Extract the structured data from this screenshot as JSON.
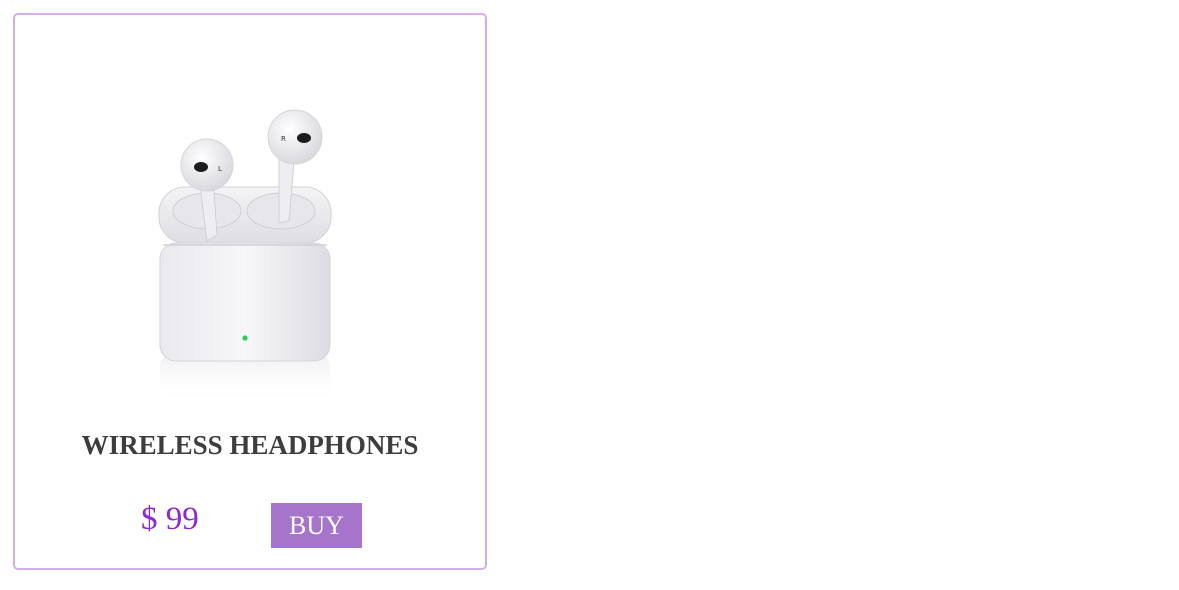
{
  "product": {
    "image_alt": "wireless-earbuds-in-charging-case",
    "title": "WIRELESS HEADPHONES",
    "price": "$ 99",
    "buy_label": "BUY"
  },
  "colors": {
    "card_border": "#d4aee4",
    "title_text": "#3d3d3d",
    "price_text": "#8d27d6",
    "button_bg": "#a674cb",
    "button_text": "#ffffff",
    "status_led": "#2ecc5a"
  }
}
